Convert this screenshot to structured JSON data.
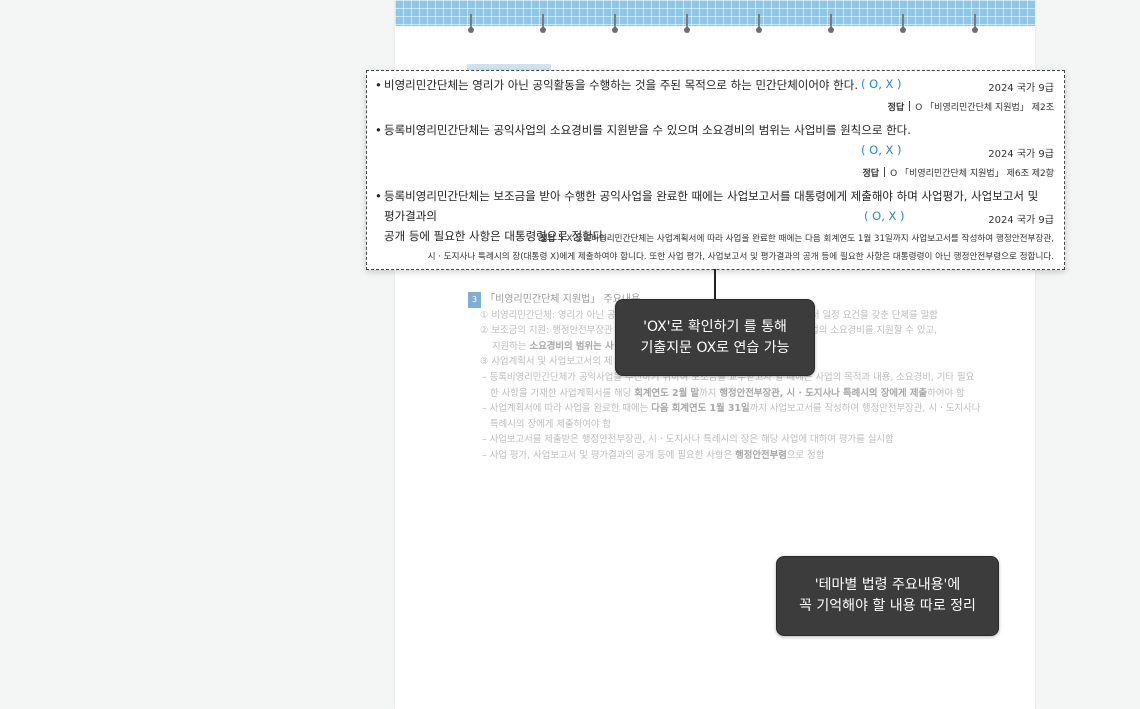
{
  "questions": [
    {
      "text": "비영리민간단체는 영리가 아닌 공익활동을 수행하는 것을 주된 목적으로 하는 민간단체이어야 한다.",
      "ox": "( O, X )",
      "source": "2024 국가 9급",
      "answer_label": "정답",
      "answer": "O 「비영리민간단체 지원법」 제2조"
    },
    {
      "text": "등록비영리민간단체는 공익사업의 소요경비를 지원받을 수 있으며 소요경비의 범위는 사업비를 원칙으로 한다.",
      "ox": "( O, X )",
      "source": "2024 국가 9급",
      "answer_label": "정답",
      "answer": "O 「비영리민간단체 지원법」 제6조 제2항"
    },
    {
      "text_line1": "등록비영리민간단체는 보조금을 받아 수행한 공익사업을 완료한 때에는 사업보고서를 대통령에게 제출해야 하며 사업평가, 사업보고서 및 평가결과의",
      "text_line2": "공개 등에 필요한 사항은 대통령령으로 정한다.",
      "ox": "( O, X )",
      "source": "2024 국가 9급",
      "answer_label": "정답",
      "answer_line1": "X 등록비영리민간단체는 사업계획서에 따라 사업을 완료한 때에는 다음 회계연도 1월 31일까지 사업보고서를 작성하여 행정안전부장관,",
      "answer_line2": "시 · 도지사나 특례시의 장(대통령 X)에게 제출하여야 합니다. 또한 사업 평가, 사업보고서 및 평가결과의 공개 등에 필요한 사항은 대통령령이 아닌 행정안전부령으로 정합니다."
    }
  ],
  "background": {
    "section_number": "3",
    "section_title": "「비영리민간단체 지원법」 주요내용",
    "item1": "① 비영리민간단체: 영리가 아닌 공",
    "item1_tail": "체로서 일정 요건을 갖춘 단체를 말함",
    "item2": "② 보조금의 지원: 행정안전부장관",
    "item2_tail": "에 공익사업의 소요경비를 지원할 수 있고,",
    "item2_cont_a": "지원하는",
    "item2_cont_bold": "소요경비의 범위는 사",
    "item3": "③ 사업계획서 및 사업보고서의 제",
    "sub1_a": "– 등록비영리민간단체가 공익사업을 추진하기 위하여 보조금을 교부받고자 할 때에는 사업의 목적과 내용, 소요경비, 기타 필요",
    "sub1_b_pre": "한 사항을 기재한 사업계획서를 해당",
    "sub1_b_bold1": "회계연도 2월 말",
    "sub1_b_mid": "까지",
    "sub1_b_bold2": "행정안전부장관, 시 · 도지사나 특례시의 장에게 제출",
    "sub1_b_post": "하여야 함",
    "sub2_a_pre": "– 사업계획서에 따라 사업을 완료한 때에는",
    "sub2_a_bold": "다음 회계연도 1월 31일",
    "sub2_a_post": "까지 사업보고서를 작성하여 행정안전부장관, 시 · 도지사나",
    "sub2_b": "특례시의 장에게 제출하여야 함",
    "sub3": "– 사업보고서를 제출받은 행정안전부장관, 시 · 도지사나 특례시의 장은 해당 사업에 대하여 평가를 실시함",
    "sub4_pre": "– 사업 평가, 사업보고서 및 평가결과의 공개 등에 필요한 사항은",
    "sub4_bold": "행정안전부령",
    "sub4_post": "으로 정함"
  },
  "callouts": {
    "ox_line1": "'OX'로 확인하기 를 통해",
    "ox_line2": "기출지문 OX로 연습 가능",
    "theme_line1": "'테마별 법령 주요내용'에",
    "theme_line2": "꼭 기억해야 할 내용 따로 정리"
  },
  "colors": {
    "ox_accent": "#2a83c6",
    "grid_strip": "#8ec6e6",
    "callout_bg": "#3c3c3c"
  }
}
